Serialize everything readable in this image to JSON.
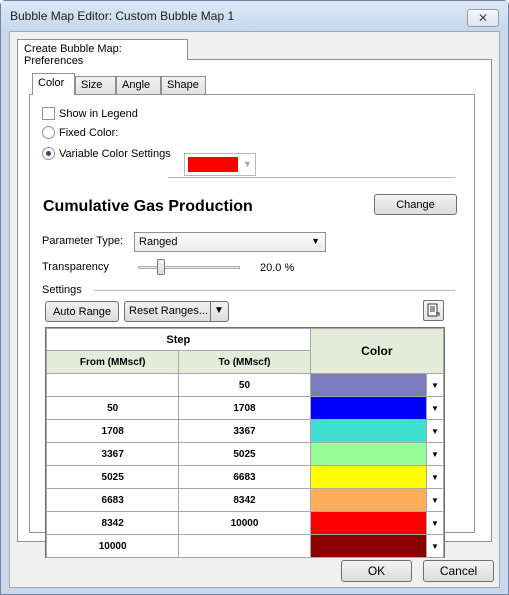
{
  "window": {
    "title": "Bubble Map Editor: Custom Bubble Map 1",
    "close_glyph": "✕"
  },
  "outer_tab": {
    "label": "Create Bubble Map: Preferences"
  },
  "inner_tabs": [
    {
      "label": "Color",
      "active": true
    },
    {
      "label": "Size",
      "active": false
    },
    {
      "label": "Angle",
      "active": false
    },
    {
      "label": "Shape",
      "active": false
    }
  ],
  "color": {
    "show_in_legend": {
      "label": "Show in Legend",
      "checked": false
    },
    "fixed_color": {
      "label": "Fixed Color:",
      "selected": false,
      "value": "#ff0000"
    },
    "variable_color": {
      "label": "Variable Color Settings",
      "selected": true
    },
    "parameter_title": "Cumulative Gas Production",
    "change_label": "Change",
    "parameter_type": {
      "label": "Parameter Type:",
      "value": "Ranged"
    },
    "transparency": {
      "label": "Transparency",
      "value": "20.0 %",
      "fraction": 0.2
    },
    "settings_label": "Settings",
    "auto_range_label": "Auto Range",
    "reset_ranges_label": "Reset Ranges...",
    "table": {
      "step_header": "Step",
      "col_from": "From (MMscf)",
      "col_to": "To (MMscf)",
      "col_color": "Color",
      "rows": [
        {
          "from": "",
          "to": "50",
          "color": "#7b7bc0"
        },
        {
          "from": "50",
          "to": "1708",
          "color": "#0000ff"
        },
        {
          "from": "1708",
          "to": "3367",
          "color": "#40e0d0"
        },
        {
          "from": "3367",
          "to": "5025",
          "color": "#98fb98"
        },
        {
          "from": "5025",
          "to": "6683",
          "color": "#ffff00"
        },
        {
          "from": "6683",
          "to": "8342",
          "color": "#ffad5a"
        },
        {
          "from": "8342",
          "to": "10000",
          "color": "#ff0000"
        },
        {
          "from": "10000",
          "to": "",
          "color": "#8b0000"
        }
      ]
    }
  },
  "footer": {
    "ok_label": "OK",
    "cancel_label": "Cancel"
  }
}
